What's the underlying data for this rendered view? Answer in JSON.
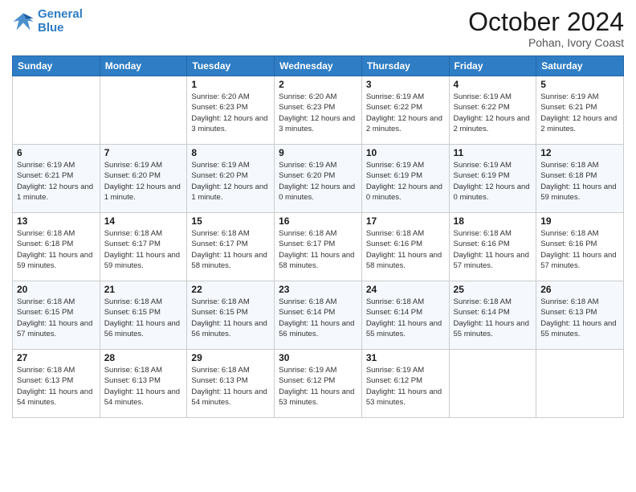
{
  "logo": {
    "line1": "General",
    "line2": "Blue"
  },
  "title": "October 2024",
  "location": "Pohan, Ivory Coast",
  "weekdays": [
    "Sunday",
    "Monday",
    "Tuesday",
    "Wednesday",
    "Thursday",
    "Friday",
    "Saturday"
  ],
  "weeks": [
    [
      {
        "day": "",
        "info": ""
      },
      {
        "day": "",
        "info": ""
      },
      {
        "day": "1",
        "info": "Sunrise: 6:20 AM\nSunset: 6:23 PM\nDaylight: 12 hours and 3 minutes."
      },
      {
        "day": "2",
        "info": "Sunrise: 6:20 AM\nSunset: 6:23 PM\nDaylight: 12 hours and 3 minutes."
      },
      {
        "day": "3",
        "info": "Sunrise: 6:19 AM\nSunset: 6:22 PM\nDaylight: 12 hours and 2 minutes."
      },
      {
        "day": "4",
        "info": "Sunrise: 6:19 AM\nSunset: 6:22 PM\nDaylight: 12 hours and 2 minutes."
      },
      {
        "day": "5",
        "info": "Sunrise: 6:19 AM\nSunset: 6:21 PM\nDaylight: 12 hours and 2 minutes."
      }
    ],
    [
      {
        "day": "6",
        "info": "Sunrise: 6:19 AM\nSunset: 6:21 PM\nDaylight: 12 hours and 1 minute."
      },
      {
        "day": "7",
        "info": "Sunrise: 6:19 AM\nSunset: 6:20 PM\nDaylight: 12 hours and 1 minute."
      },
      {
        "day": "8",
        "info": "Sunrise: 6:19 AM\nSunset: 6:20 PM\nDaylight: 12 hours and 1 minute."
      },
      {
        "day": "9",
        "info": "Sunrise: 6:19 AM\nSunset: 6:20 PM\nDaylight: 12 hours and 0 minutes."
      },
      {
        "day": "10",
        "info": "Sunrise: 6:19 AM\nSunset: 6:19 PM\nDaylight: 12 hours and 0 minutes."
      },
      {
        "day": "11",
        "info": "Sunrise: 6:19 AM\nSunset: 6:19 PM\nDaylight: 12 hours and 0 minutes."
      },
      {
        "day": "12",
        "info": "Sunrise: 6:18 AM\nSunset: 6:18 PM\nDaylight: 11 hours and 59 minutes."
      }
    ],
    [
      {
        "day": "13",
        "info": "Sunrise: 6:18 AM\nSunset: 6:18 PM\nDaylight: 11 hours and 59 minutes."
      },
      {
        "day": "14",
        "info": "Sunrise: 6:18 AM\nSunset: 6:17 PM\nDaylight: 11 hours and 59 minutes."
      },
      {
        "day": "15",
        "info": "Sunrise: 6:18 AM\nSunset: 6:17 PM\nDaylight: 11 hours and 58 minutes."
      },
      {
        "day": "16",
        "info": "Sunrise: 6:18 AM\nSunset: 6:17 PM\nDaylight: 11 hours and 58 minutes."
      },
      {
        "day": "17",
        "info": "Sunrise: 6:18 AM\nSunset: 6:16 PM\nDaylight: 11 hours and 58 minutes."
      },
      {
        "day": "18",
        "info": "Sunrise: 6:18 AM\nSunset: 6:16 PM\nDaylight: 11 hours and 57 minutes."
      },
      {
        "day": "19",
        "info": "Sunrise: 6:18 AM\nSunset: 6:16 PM\nDaylight: 11 hours and 57 minutes."
      }
    ],
    [
      {
        "day": "20",
        "info": "Sunrise: 6:18 AM\nSunset: 6:15 PM\nDaylight: 11 hours and 57 minutes."
      },
      {
        "day": "21",
        "info": "Sunrise: 6:18 AM\nSunset: 6:15 PM\nDaylight: 11 hours and 56 minutes."
      },
      {
        "day": "22",
        "info": "Sunrise: 6:18 AM\nSunset: 6:15 PM\nDaylight: 11 hours and 56 minutes."
      },
      {
        "day": "23",
        "info": "Sunrise: 6:18 AM\nSunset: 6:14 PM\nDaylight: 11 hours and 56 minutes."
      },
      {
        "day": "24",
        "info": "Sunrise: 6:18 AM\nSunset: 6:14 PM\nDaylight: 11 hours and 55 minutes."
      },
      {
        "day": "25",
        "info": "Sunrise: 6:18 AM\nSunset: 6:14 PM\nDaylight: 11 hours and 55 minutes."
      },
      {
        "day": "26",
        "info": "Sunrise: 6:18 AM\nSunset: 6:13 PM\nDaylight: 11 hours and 55 minutes."
      }
    ],
    [
      {
        "day": "27",
        "info": "Sunrise: 6:18 AM\nSunset: 6:13 PM\nDaylight: 11 hours and 54 minutes."
      },
      {
        "day": "28",
        "info": "Sunrise: 6:18 AM\nSunset: 6:13 PM\nDaylight: 11 hours and 54 minutes."
      },
      {
        "day": "29",
        "info": "Sunrise: 6:18 AM\nSunset: 6:13 PM\nDaylight: 11 hours and 54 minutes."
      },
      {
        "day": "30",
        "info": "Sunrise: 6:19 AM\nSunset: 6:12 PM\nDaylight: 11 hours and 53 minutes."
      },
      {
        "day": "31",
        "info": "Sunrise: 6:19 AM\nSunset: 6:12 PM\nDaylight: 11 hours and 53 minutes."
      },
      {
        "day": "",
        "info": ""
      },
      {
        "day": "",
        "info": ""
      }
    ]
  ]
}
